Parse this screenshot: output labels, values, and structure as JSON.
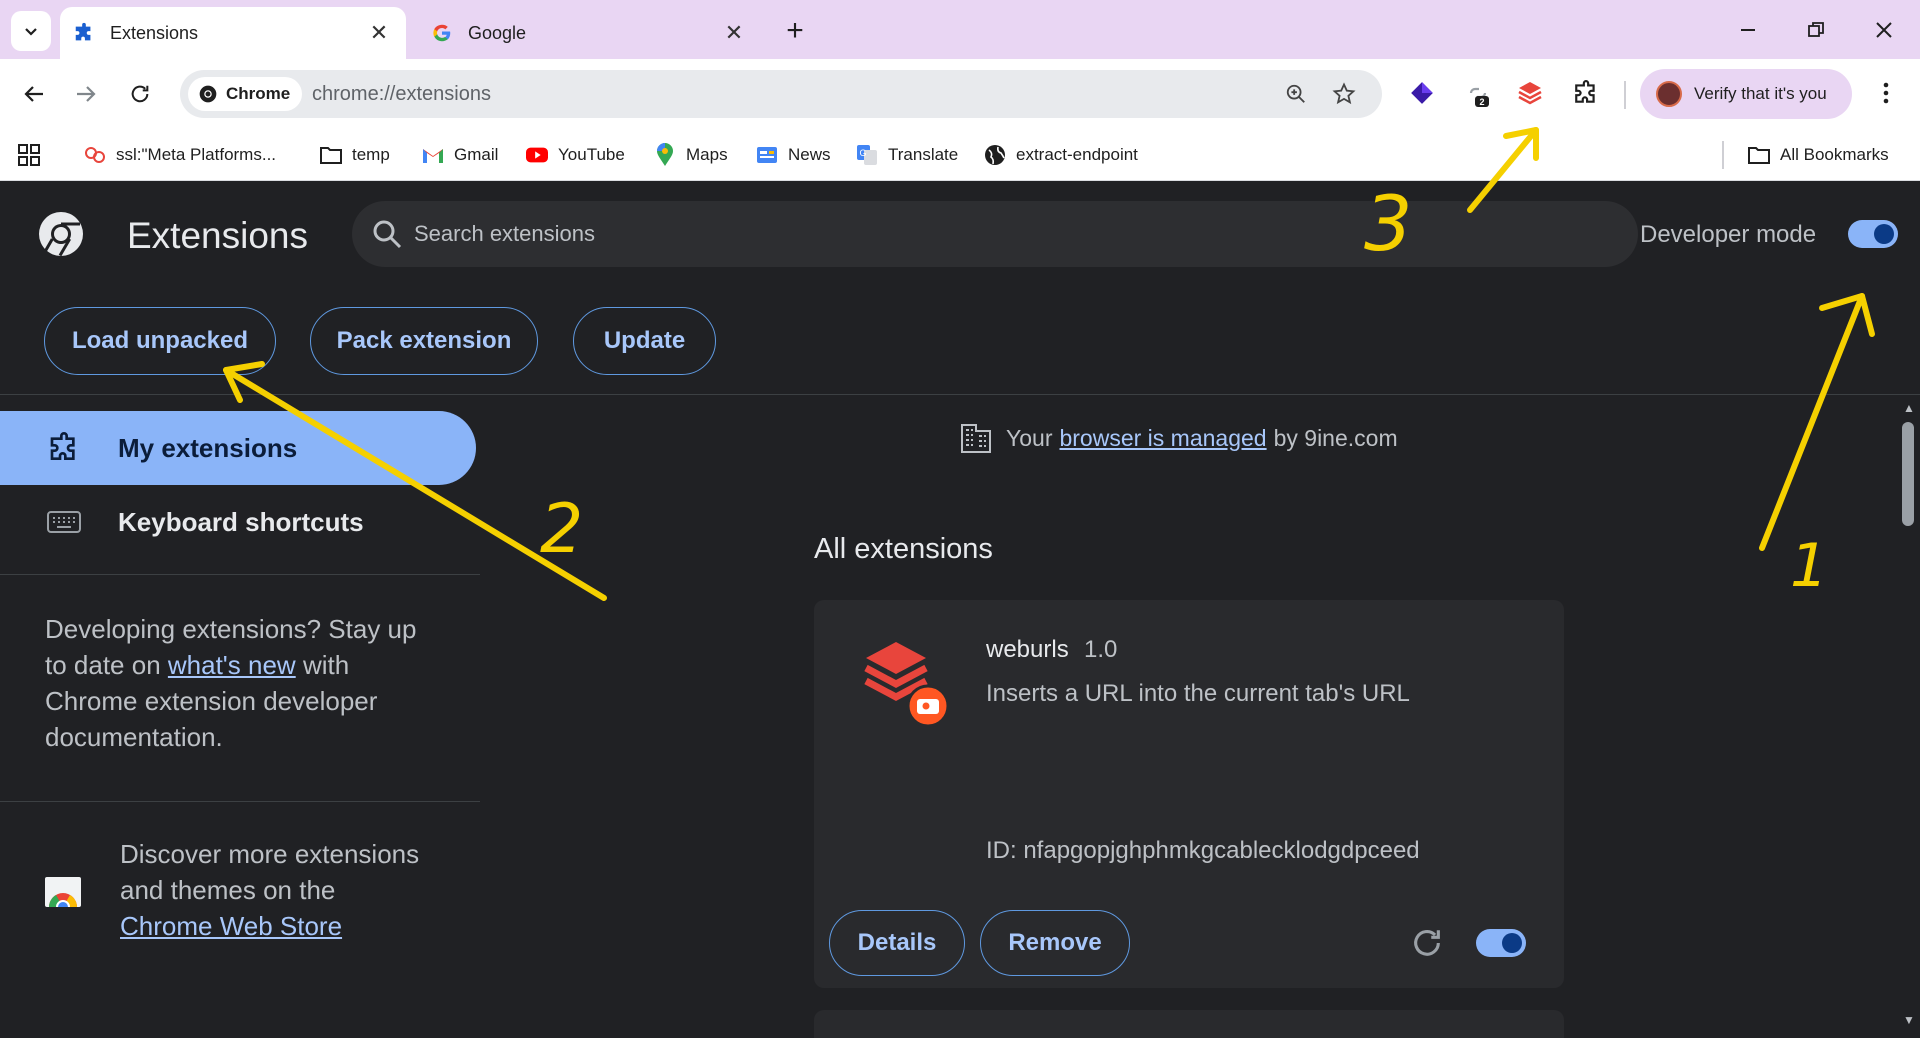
{
  "browser": {
    "tabs": [
      {
        "title": "Extensions",
        "icon": "puzzle-icon",
        "active": true
      },
      {
        "title": "Google",
        "icon": "google-icon",
        "active": false
      }
    ],
    "omnibox": {
      "chip_label": "Chrome",
      "url": "chrome://extensions"
    },
    "profile": {
      "label": "Verify that it's you"
    },
    "extension_badge": "2",
    "bookmarks": [
      {
        "label": "ssl:\"Meta Platforms...",
        "icon": "meta-icon"
      },
      {
        "label": "temp",
        "icon": "folder-icon"
      },
      {
        "label": "Gmail",
        "icon": "gmail-icon"
      },
      {
        "label": "YouTube",
        "icon": "youtube-icon"
      },
      {
        "label": "Maps",
        "icon": "maps-icon"
      },
      {
        "label": "News",
        "icon": "news-icon"
      },
      {
        "label": "Translate",
        "icon": "translate-icon"
      },
      {
        "label": "extract-endpoint",
        "icon": "globe-icon"
      }
    ],
    "all_bookmarks_label": "All Bookmarks"
  },
  "header": {
    "title": "Extensions",
    "search_placeholder": "Search extensions",
    "developer_mode_label": "Developer mode",
    "developer_mode_on": true,
    "buttons": {
      "load_unpacked": "Load unpacked",
      "pack_extension": "Pack extension",
      "update": "Update"
    }
  },
  "sidebar": {
    "items": [
      {
        "label": "My extensions",
        "selected": true
      },
      {
        "label": "Keyboard shortcuts",
        "selected": false
      }
    ],
    "dev_text_1": "Developing extensions? Stay up",
    "dev_text_2_pre": "to date on",
    "dev_text_2_link": "what's new",
    "dev_text_2_post": "with",
    "dev_text_3": "Chrome extension developer",
    "dev_text_4": "documentation.",
    "store_text_1": "Discover more extensions",
    "store_text_2": "and themes on the",
    "store_link": "Chrome Web Store"
  },
  "main": {
    "managed_pre": "Your",
    "managed_link": "browser is managed",
    "managed_post": "by 9ine.com",
    "section_title": "All extensions",
    "extensions": [
      {
        "name": "weburls",
        "version": "1.0",
        "description": "Inserts a URL into the current tab's URL",
        "id_text": "ID: nfapgopjghphmkgcablecklodgdpceed",
        "enabled": true,
        "details_label": "Details",
        "remove_label": "Remove"
      }
    ]
  },
  "annotations": {
    "arrow_1_label": "1",
    "arrow_2_label": "2",
    "arrow_3_label": "3",
    "color": "#f5d000"
  },
  "colors": {
    "tabstrip": "#e9d6f3",
    "accent": "#8ab4f8",
    "background": "#202124",
    "card": "#292a2d"
  }
}
